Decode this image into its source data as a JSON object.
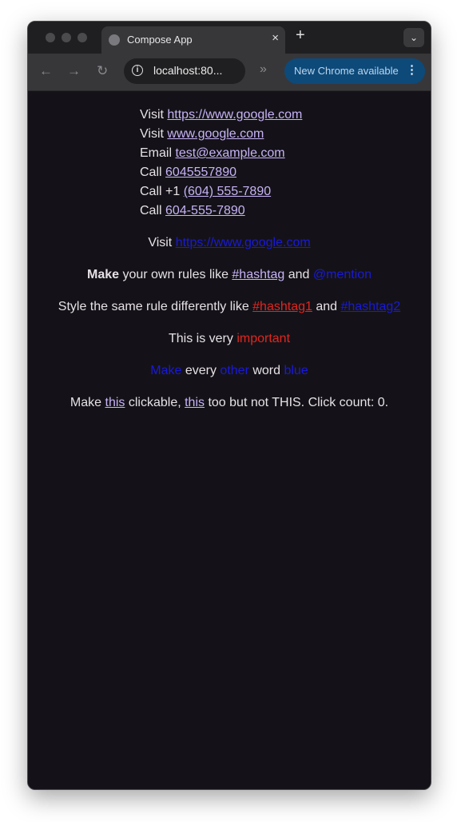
{
  "browser": {
    "tab_title": "Compose App",
    "tab_close": "×",
    "new_tab": "+",
    "tab_menu": "⌄",
    "address": "localhost:80...",
    "extensions": "»",
    "update_label": "New Chrome available",
    "update_menu": "⋮"
  },
  "links_block": [
    {
      "prefix": "Visit ",
      "link": "https://www.google.com"
    },
    {
      "prefix": "Visit ",
      "link": "www.google.com"
    },
    {
      "prefix": "Email ",
      "link": "test@example.com"
    },
    {
      "prefix": "Call ",
      "link": "6045557890"
    },
    {
      "prefix": "Call +1 ",
      "link": "(604) 555-7890"
    },
    {
      "prefix": "Call ",
      "link": "604-555-7890"
    }
  ],
  "visit_line": {
    "prefix": "Visit ",
    "link": "https://www.google.com"
  },
  "rules_line": {
    "make": "Make",
    "middle": " your own rules like ",
    "hashtag": "#hashtag",
    "and": " and ",
    "mention": "@mention"
  },
  "style_line": {
    "prefix": "Style the same rule differently like ",
    "hashtag1": "#hashtag1",
    "and": " and ",
    "hashtag2": "#hashtag2"
  },
  "important_line": {
    "prefix": "This is very ",
    "important": "important"
  },
  "every_line": {
    "w1": "Make",
    "w2": " every ",
    "w3": " other ",
    "w4": " word ",
    "w5": "blue"
  },
  "click_line": {
    "p1": "Make ",
    "this1": "this",
    "p2": " clickable, ",
    "this2": "this",
    "p3": " too but not THIS. Click count: 0."
  },
  "colors": {
    "link": "#c6b3f5",
    "blue": "#1a1ad6",
    "red": "#e0261f",
    "background": "#141218",
    "text": "#e6e1e5"
  }
}
